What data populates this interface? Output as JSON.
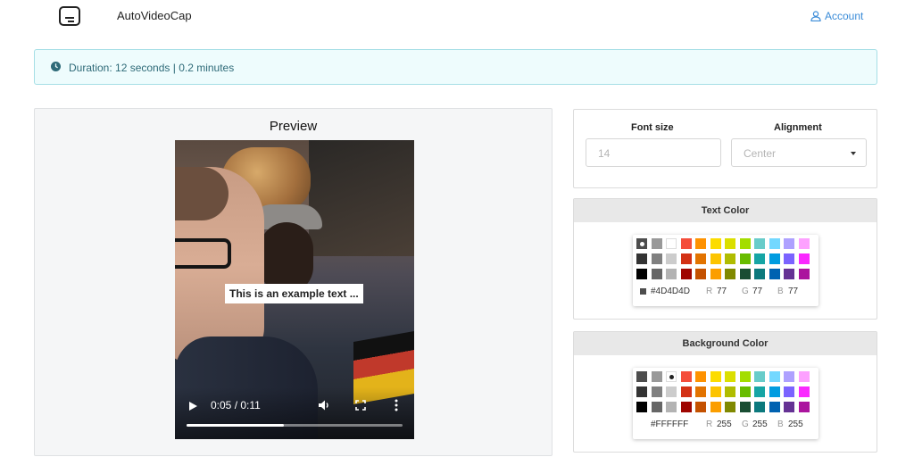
{
  "nav": {
    "brand": "AutoVideoCap",
    "account_label": "Account"
  },
  "alert": {
    "text": "Duration: 12 seconds | 0.2 minutes"
  },
  "preview": {
    "title": "Preview",
    "caption": "This is an example text ...",
    "time": "0:05 / 0:11",
    "progress": 0.45
  },
  "settings": {
    "font_size_label": "Font size",
    "font_size_placeholder": "14",
    "alignment_label": "Alignment",
    "alignment_value": "Center"
  },
  "palette": [
    [
      "#4D4D4D",
      "#999999",
      "#FFFFFF",
      "#F44E3B",
      "#FE9200",
      "#FCDC00",
      "#DBDF00",
      "#A4DD00",
      "#68CCCA",
      "#73D8FF",
      "#AEA1FF",
      "#FDA1FF"
    ],
    [
      "#333333",
      "#808080",
      "#CCCCCC",
      "#D33115",
      "#E27300",
      "#FCC400",
      "#B0BC00",
      "#68BC00",
      "#16A5A5",
      "#009CE0",
      "#7B64FF",
      "#FA28FF"
    ],
    [
      "#000000",
      "#666666",
      "#B3B3B3",
      "#9F0500",
      "#C45100",
      "#FB9E00",
      "#808900",
      "#194D33",
      "#0C797D",
      "#0062B1",
      "#653294",
      "#AB149E"
    ]
  ],
  "text_color": {
    "title": "Text Color",
    "hex": "#4D4D4D",
    "r_label": "R",
    "r": "77",
    "g_label": "G",
    "g": "77",
    "b_label": "B",
    "b": "77"
  },
  "background_color": {
    "title": "Background Color",
    "hex": "#FFFFFF",
    "r_label": "R",
    "r": "255",
    "g_label": "G",
    "g": "255",
    "b_label": "B",
    "b": "255"
  }
}
